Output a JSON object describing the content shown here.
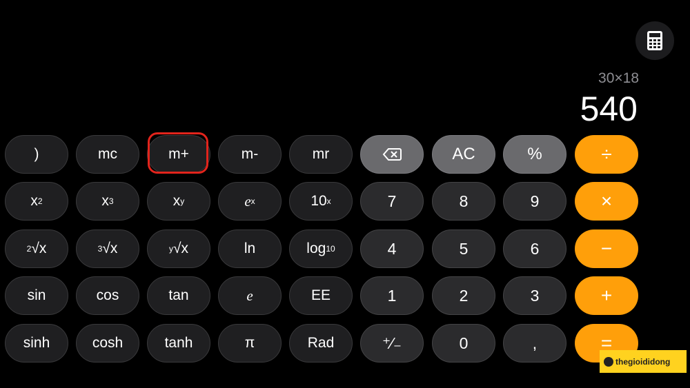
{
  "display": {
    "expression": "30×18",
    "result": "540"
  },
  "keys": {
    "r0": {
      "c0": ")",
      "c1": "mc",
      "c2": "m+",
      "c3": "m-",
      "c4": "mr",
      "c5": "⌫",
      "c6": "AC",
      "c7": "%",
      "c8": "÷"
    },
    "r1": {
      "c0": "x",
      "c0s": "2",
      "c1": "x",
      "c1s": "3",
      "c2": "x",
      "c2s": "y",
      "c3": "e",
      "c3s": "x",
      "c4": "10",
      "c4s": "x",
      "c5": "7",
      "c6": "8",
      "c7": "9",
      "c8": "×"
    },
    "r2": {
      "c0": "√x",
      "c0s": "2",
      "c1": "√x",
      "c1s": "3",
      "c2": "√x",
      "c2s": "y",
      "c3": "ln",
      "c4": "log",
      "c4s": "10",
      "c5": "4",
      "c6": "5",
      "c7": "6",
      "c8": "−"
    },
    "r3": {
      "c0": "sin",
      "c1": "cos",
      "c2": "tan",
      "c3": "e",
      "c4": "EE",
      "c5": "1",
      "c6": "2",
      "c7": "3",
      "c8": "+"
    },
    "r4": {
      "c0": "sinh",
      "c1": "cosh",
      "c2": "tanh",
      "c3": "π",
      "c4": "Rad",
      "c5": "⁺∕₋",
      "c6": "0",
      "c7": ",",
      "c8": "="
    }
  },
  "watermark": "thegioididong",
  "colors": {
    "operator": "#ff9f0a",
    "highlight": "#e2241c"
  }
}
